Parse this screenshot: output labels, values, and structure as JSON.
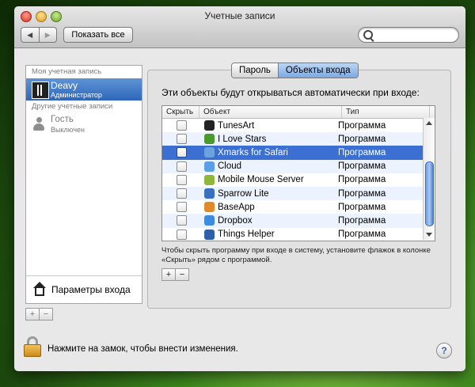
{
  "window": {
    "title": "Учетные записи",
    "nav": {
      "back": "◀",
      "forward": "▶"
    },
    "show_all": "Показать все",
    "search": {
      "placeholder": ""
    }
  },
  "sidebar": {
    "my_account_header": "Моя учетная запись",
    "my_account": {
      "name": "Deavy",
      "role": "Администратор"
    },
    "other_accounts_header": "Другие учетные записи",
    "other_accounts": [
      {
        "name": "Гость",
        "role": "Выключен"
      }
    ],
    "login_options": "Параметры входа",
    "add": "+",
    "remove": "−"
  },
  "tabs": [
    {
      "label": "Пароль",
      "active": false
    },
    {
      "label": "Объекты входа",
      "active": true
    }
  ],
  "login_items": {
    "heading": "Эти объекты будут открываться автоматически при входе:",
    "columns": {
      "hide": "Скрыть",
      "item": "Объект",
      "kind": "Тип"
    },
    "rows": [
      {
        "name": "TunesArt",
        "kind": "Программа",
        "hidden": false,
        "icon": "tunesart-icon",
        "color": "#222222"
      },
      {
        "name": "I Love Stars",
        "kind": "Программа",
        "hidden": false,
        "icon": "star-icon",
        "color": "#4a9a2e"
      },
      {
        "name": "Xmarks for Safari",
        "kind": "Программа",
        "hidden": false,
        "icon": "xmarks-icon",
        "color": "#6aa3de",
        "selected": true
      },
      {
        "name": "Cloud",
        "kind": "Программа",
        "hidden": false,
        "icon": "cloud-icon",
        "color": "#5a9ee6"
      },
      {
        "name": "Mobile Mouse Server",
        "kind": "Программа",
        "hidden": false,
        "icon": "mobile-mouse-icon",
        "color": "#8fb83a"
      },
      {
        "name": "Sparrow Lite",
        "kind": "Программа",
        "hidden": false,
        "icon": "sparrow-icon",
        "color": "#3a6fbf"
      },
      {
        "name": "BaseApp",
        "kind": "Программа",
        "hidden": false,
        "icon": "baseapp-icon",
        "color": "#e08a2a"
      },
      {
        "name": "Dropbox",
        "kind": "Программа",
        "hidden": false,
        "icon": "dropbox-icon",
        "color": "#3d8be0"
      },
      {
        "name": "Things Helper",
        "kind": "Программа",
        "hidden": false,
        "icon": "things-icon",
        "color": "#2f5fa8"
      }
    ],
    "hint": "Чтобы скрыть программу при входе в систему, установите флажок в колонке «Скрыть» рядом с программой.",
    "add": "+",
    "remove": "−"
  },
  "footer": {
    "lock_text": "Нажмите на замок, чтобы внести изменения.",
    "help": "?"
  }
}
